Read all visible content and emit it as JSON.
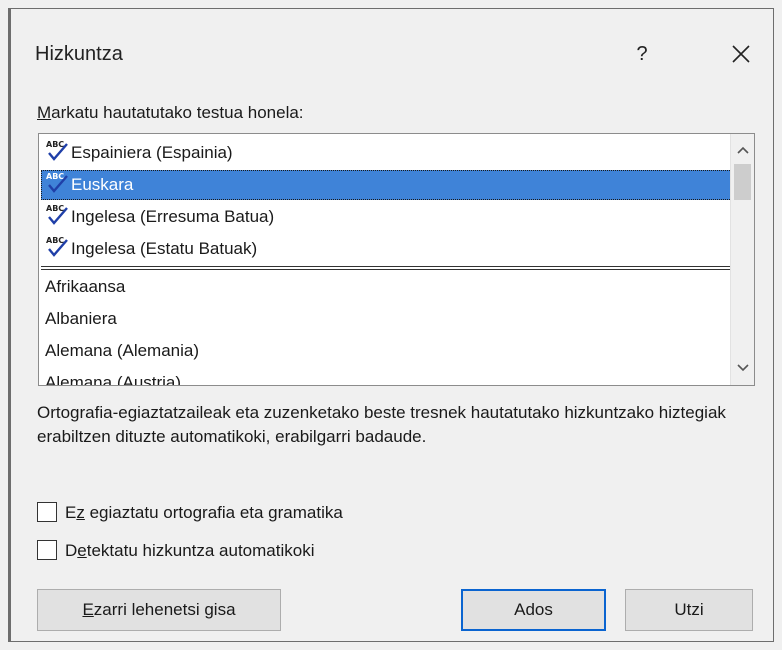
{
  "dialog": {
    "title": "Hizkuntza",
    "help_label": "?",
    "prompt": {
      "accel": "M",
      "rest": "arkatu hautatutako testua honela:"
    },
    "languages_top": [
      {
        "label": "Espainiera (Espainia)",
        "icon": "spellcheck-icon"
      },
      {
        "label": "Euskara",
        "icon": "spellcheck-icon",
        "selected": true
      },
      {
        "label": "Ingelesa (Erresuma Batua)",
        "icon": "spellcheck-icon"
      },
      {
        "label": "Ingelesa (Estatu Batuak)",
        "icon": "spellcheck-icon"
      }
    ],
    "languages_all": [
      {
        "label": "Afrikaansa"
      },
      {
        "label": "Albaniera"
      },
      {
        "label": "Alemana (Alemania)"
      },
      {
        "label": "Alemana (Austria)"
      }
    ],
    "description": "Ortografia-egiaztatzaileak eta zuzenketako beste tresnek hautatutako hizkuntzako hiztegiak erabiltzen dituzte automatikoki, erabilgarri badaude.",
    "checkbox_no_proof": {
      "pre": "E",
      "accel": "z",
      "rest": " egiaztatu ortografia eta gramatika",
      "checked": false
    },
    "checkbox_detect": {
      "pre": "D",
      "accel": "e",
      "rest": "tektatu hizkuntza automatikoki",
      "checked": false
    },
    "set_default": {
      "accel": "E",
      "rest": "zarri lehenetsi gisa"
    },
    "ok_label": "Ados",
    "cancel_label": "Utzi"
  },
  "colors": {
    "selection": "#3f83d8",
    "default_button_border": "#0a64d0",
    "background": "#f0f0f0"
  }
}
